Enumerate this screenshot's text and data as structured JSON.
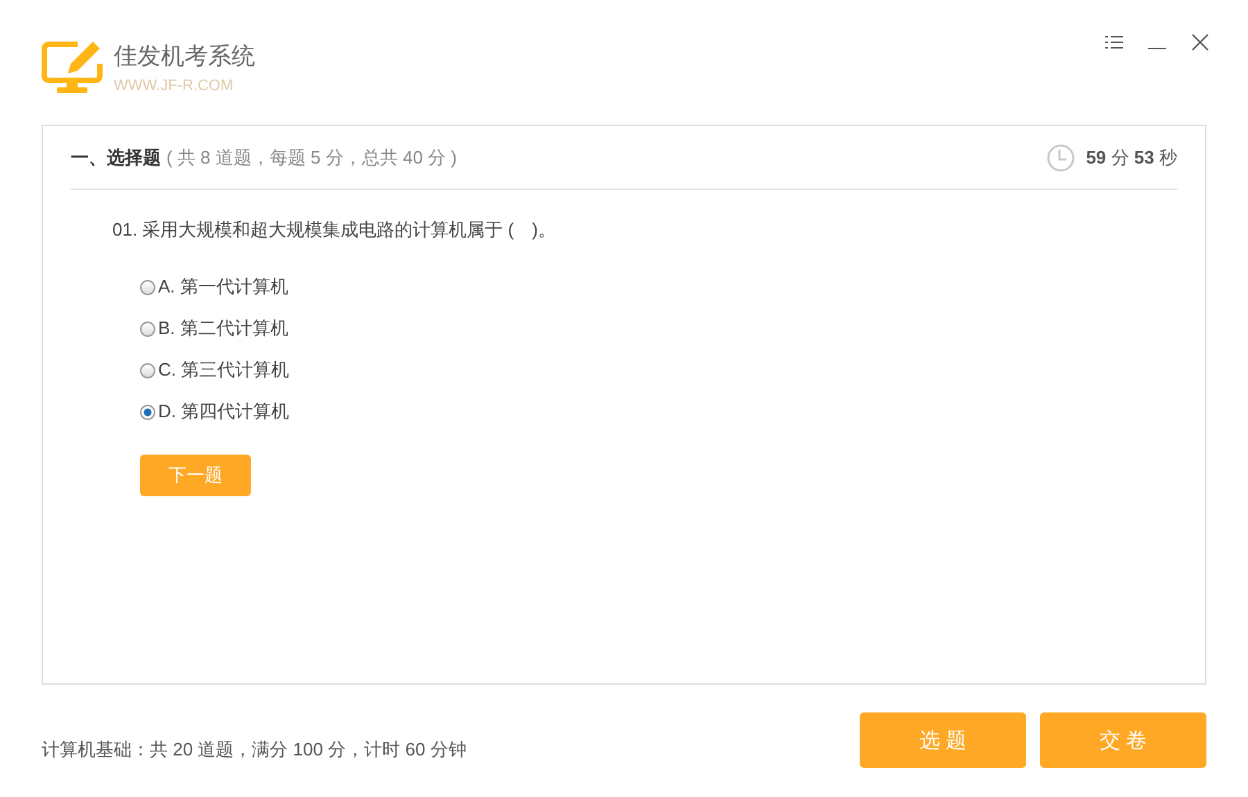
{
  "app": {
    "title": "佳发机考系统",
    "subtitle": "WWW.JF-R.COM"
  },
  "section": {
    "title": "一、选择题",
    "info": "( 共 8 道题，每题 5 分，总共 40 分 )",
    "timer": "**59** 分 **53** 秒"
  },
  "question": {
    "text": "01. 采用大规模和超大规模集成电路的计算机属于 (　)。",
    "options": [
      {
        "label": "A. 第一代计算机",
        "selected": false
      },
      {
        "label": "B. 第二代计算机",
        "selected": false
      },
      {
        "label": "C. 第三代计算机",
        "selected": false
      },
      {
        "label": "D. 第四代计算机",
        "selected": true
      }
    ],
    "next_button": "下一题"
  },
  "footer": {
    "summary": "计算机基础：共 20 道题，满分 100 分，计时 60 分钟",
    "buttons": [
      "选 题",
      "交 卷"
    ]
  }
}
